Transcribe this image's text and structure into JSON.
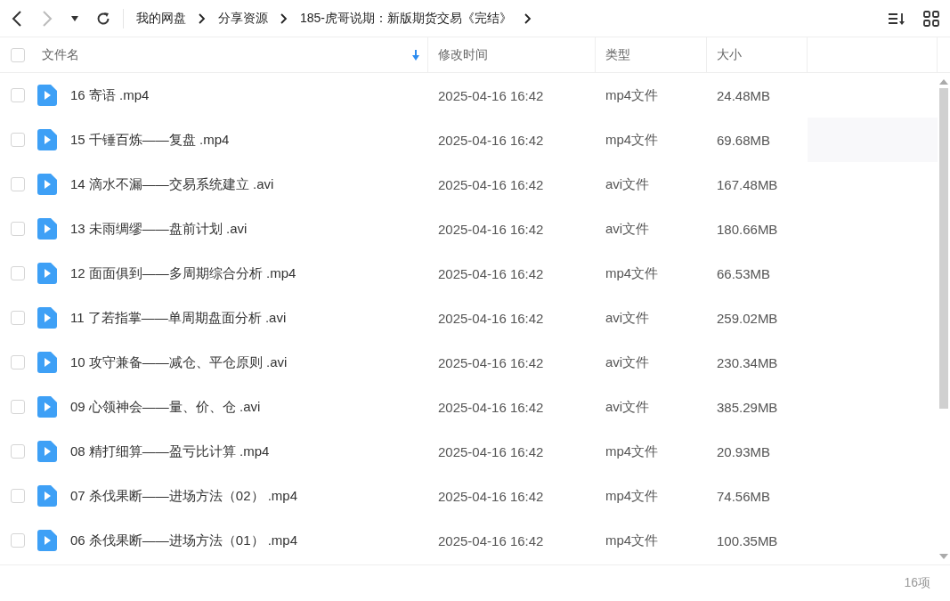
{
  "breadcrumb": [
    "我的网盘",
    "分享资源",
    "185-虎哥说期：新版期货交易《完结》"
  ],
  "table": {
    "all_checked": false,
    "columns": [
      {
        "label": "文件名",
        "sorted": true
      },
      {
        "label": "修改时间",
        "sorted": false
      },
      {
        "label": "类型",
        "sorted": false
      },
      {
        "label": "大小",
        "sorted": false
      }
    ],
    "rows": [
      {
        "name": "16 寄语 .mp4",
        "time": "2025-04-16 16:42",
        "type": "mp4文件",
        "size": "24.48MB",
        "checked": false,
        "hovered": false
      },
      {
        "name": "15 千锤百炼——复盘 .mp4",
        "time": "2025-04-16 16:42",
        "type": "mp4文件",
        "size": "69.68MB",
        "checked": false,
        "hovered": true
      },
      {
        "name": "14 滴水不漏——交易系统建立 .avi",
        "time": "2025-04-16 16:42",
        "type": "avi文件",
        "size": "167.48MB",
        "checked": false,
        "hovered": false
      },
      {
        "name": "13 未雨绸缪——盘前计划 .avi",
        "time": "2025-04-16 16:42",
        "type": "avi文件",
        "size": "180.66MB",
        "checked": false,
        "hovered": false
      },
      {
        "name": "12 面面俱到——多周期综合分析 .mp4",
        "time": "2025-04-16 16:42",
        "type": "mp4文件",
        "size": "66.53MB",
        "checked": false,
        "hovered": false
      },
      {
        "name": "11 了若指掌——单周期盘面分析 .avi",
        "time": "2025-04-16 16:42",
        "type": "avi文件",
        "size": "259.02MB",
        "checked": false,
        "hovered": false
      },
      {
        "name": "10 攻守兼备——减仓、平仓原则 .avi",
        "time": "2025-04-16 16:42",
        "type": "avi文件",
        "size": "230.34MB",
        "checked": false,
        "hovered": false
      },
      {
        "name": "09 心领神会——量、价、仓 .avi",
        "time": "2025-04-16 16:42",
        "type": "avi文件",
        "size": "385.29MB",
        "checked": false,
        "hovered": false
      },
      {
        "name": "08 精打细算——盈亏比计算 .mp4",
        "time": "2025-04-16 16:42",
        "type": "mp4文件",
        "size": "20.93MB",
        "checked": false,
        "hovered": false
      },
      {
        "name": "07 杀伐果断——进场方法（02） .mp4",
        "time": "2025-04-16 16:42",
        "type": "mp4文件",
        "size": "74.56MB",
        "checked": false,
        "hovered": false
      },
      {
        "name": "06 杀伐果断——进场方法（01） .mp4",
        "time": "2025-04-16 16:42",
        "type": "mp4文件",
        "size": "100.35MB",
        "checked": false,
        "hovered": false
      }
    ]
  },
  "status_bar": {
    "count": "16项"
  }
}
